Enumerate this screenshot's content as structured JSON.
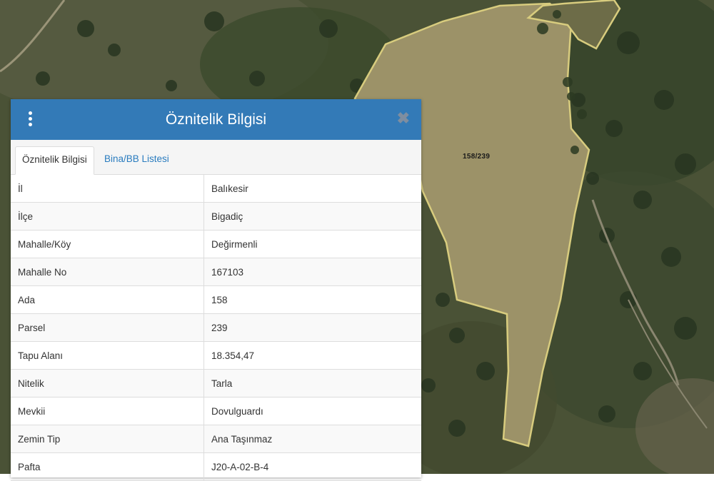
{
  "map": {
    "parcel_label": "158/239"
  },
  "panel": {
    "title": "Öznitelik Bilgisi",
    "menu_icon": "vertical-ellipsis-icon",
    "close_icon": "close-icon",
    "close_glyph": "✖",
    "tabs": [
      {
        "label": "Öznitelik Bilgisi",
        "active": true
      },
      {
        "label": "Bina/BB Listesi",
        "active": false
      }
    ],
    "rows": [
      {
        "key": "İl",
        "value": "Balıkesir"
      },
      {
        "key": "İlçe",
        "value": "Bigadiç"
      },
      {
        "key": "Mahalle/Köy",
        "value": "Değirmenli"
      },
      {
        "key": "Mahalle No",
        "value": "167103"
      },
      {
        "key": "Ada",
        "value": "158"
      },
      {
        "key": "Parsel",
        "value": "239"
      },
      {
        "key": "Tapu Alanı",
        "value": "18.354,47"
      },
      {
        "key": "Nitelik",
        "value": "Tarla"
      },
      {
        "key": "Mevkii",
        "value": "Dovulguardı"
      },
      {
        "key": "Zemin Tip",
        "value": "Ana Taşınmaz"
      },
      {
        "key": "Pafta",
        "value": "J20-A-02-B-4"
      }
    ]
  },
  "colors": {
    "header": "#337ab7",
    "parcel_outline": "#d8cc7e",
    "tab_link": "#2a7cbf"
  }
}
